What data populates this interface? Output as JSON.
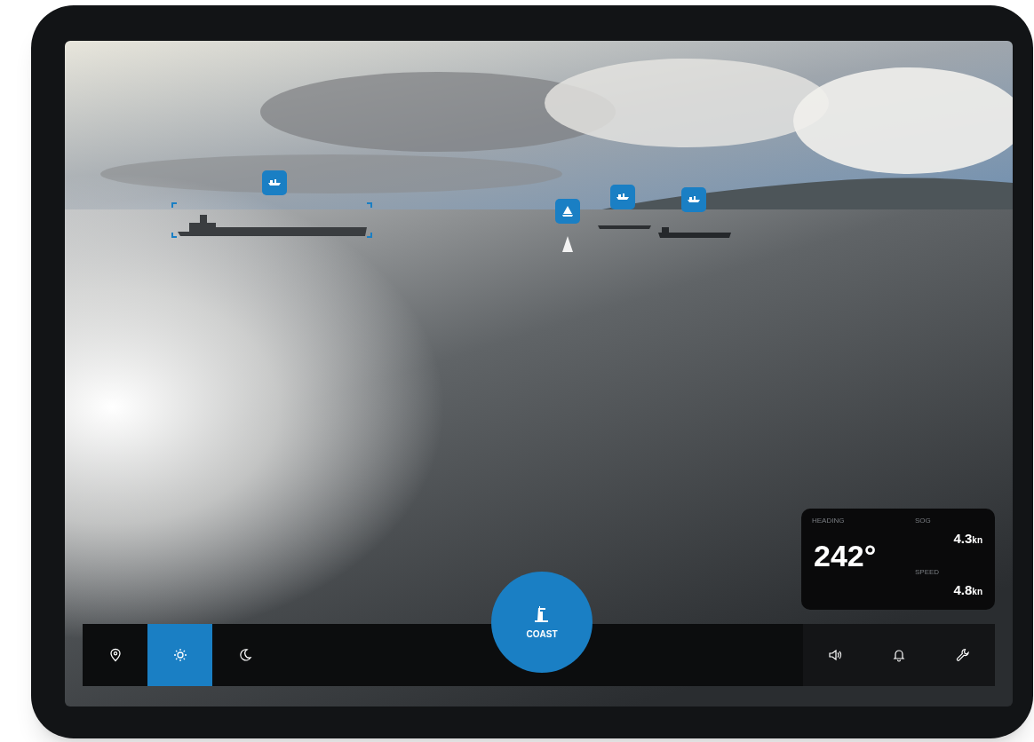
{
  "markers": [
    {
      "kind": "ship"
    },
    {
      "kind": "sailboat"
    },
    {
      "kind": "ship"
    },
    {
      "kind": "ship"
    }
  ],
  "instruments": {
    "heading": {
      "label": "HEADING",
      "value": "242°"
    },
    "sog": {
      "label": "SOG",
      "value": "4.3",
      "unit": "kn"
    },
    "speed": {
      "label": "SPEED",
      "value": "4.8",
      "unit": "kn"
    }
  },
  "modes": [
    {
      "kind": "location",
      "selected": false
    },
    {
      "kind": "day",
      "selected": true
    },
    {
      "kind": "night",
      "selected": false
    }
  ],
  "coast_button": {
    "label": "COAST"
  },
  "tools": [
    {
      "kind": "sound"
    },
    {
      "kind": "bell"
    },
    {
      "kind": "wrench"
    }
  ]
}
